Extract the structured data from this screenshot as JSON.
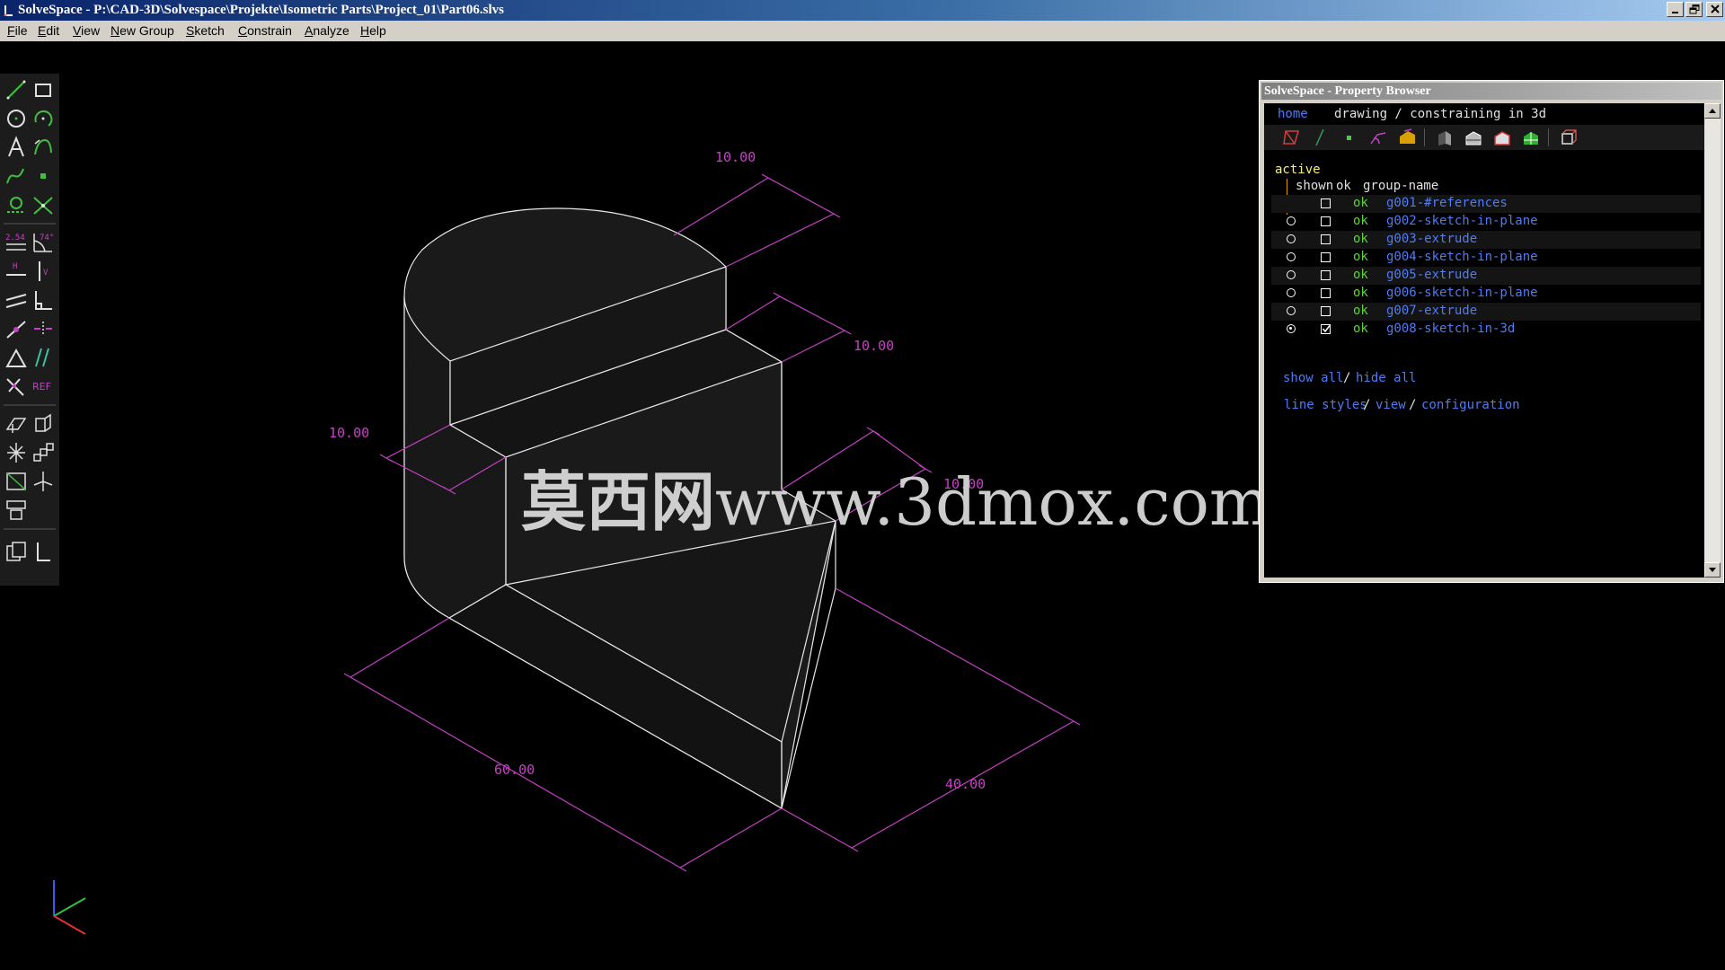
{
  "window": {
    "title": "SolveSpace - P:\\CAD-3D\\Solvespace\\Projekte\\Isometric Parts\\Project_01\\Part06.slvs",
    "icon": "solvespace-app-icon",
    "controls": [
      "minimize-icon",
      "restore-icon",
      "close-icon"
    ]
  },
  "menu": [
    {
      "key": "F",
      "rest": "ile"
    },
    {
      "key": "E",
      "rest": "dit"
    },
    {
      "key": "V",
      "rest": "iew"
    },
    {
      "key": "N",
      "rest": "ew Group"
    },
    {
      "key": "S",
      "rest": "ketch"
    },
    {
      "key": "C",
      "rest": "onstrain"
    },
    {
      "key": "A",
      "rest": "nalyze"
    },
    {
      "key": "H",
      "rest": "elp"
    }
  ],
  "toolbar": {
    "tools": [
      "line-icon",
      "rectangle-icon",
      "circle-icon",
      "arc-icon",
      "text-icon",
      "tangent-arc-icon",
      "bezier-icon",
      "point-icon",
      "construction-icon",
      "split-icon",
      "distance-icon",
      "angle-icon",
      "horizontal-icon",
      "vertical-icon",
      "parallel-icon",
      "perpendicular-icon",
      "point-on-line-icon",
      "symmetric-icon",
      "equal-icon",
      "other-angle-icon",
      "reference-icon",
      "workplane-icon",
      "extrude-icon",
      "lathe-icon",
      "step-rotate-icon",
      "step-translate-icon",
      "sketch-in-plane-icon",
      "sketch-in-3d-icon",
      "assemble-icon",
      "link-icon",
      "nearest-iso-icon"
    ],
    "reference_label": "REF",
    "distance_label": "2.54",
    "angle_label": "74°",
    "horizontal_label": "H",
    "vertical_label": "V"
  },
  "dimensions": {
    "d1": "10.00",
    "d2": "10.00",
    "d3": "10.00",
    "d4": "10.00",
    "d5": "60.00",
    "d6": "40.00"
  },
  "watermark": {
    "cn": "莫西网",
    "url": "www.3dmox.com"
  },
  "colors": {
    "dimension": "#c540c5",
    "edge": "#e8e8e8",
    "link": "#4f7cf5",
    "ok": "#5fd23c",
    "axis_x": "#e03030",
    "axis_y": "#30c040",
    "axis_z": "#3a5cf0"
  },
  "property_browser": {
    "title": "SolveSpace - Property Browser",
    "nav": {
      "home": "home",
      "crumb": "drawing / constraining in 3d"
    },
    "icons": [
      "hide-workplanes-icon",
      "hide-normals-icon",
      "hide-points-icon",
      "hide-constraints-icon",
      "hide-faces-icon",
      "show-shaded-icon",
      "show-edges-icon",
      "show-outlines-icon",
      "show-mesh-icon",
      "show-hidden-lines-icon"
    ],
    "active_label": "active",
    "headers": {
      "shown": "shown",
      "ok": "ok",
      "name": "group-name"
    },
    "groups": [
      {
        "name": "g001-#references",
        "ok": "ok",
        "radio": false,
        "checked": false
      },
      {
        "name": "g002-sketch-in-plane",
        "ok": "ok",
        "radio": true,
        "checked": false
      },
      {
        "name": "g003-extrude",
        "ok": "ok",
        "radio": true,
        "checked": false
      },
      {
        "name": "g004-sketch-in-plane",
        "ok": "ok",
        "radio": true,
        "checked": false
      },
      {
        "name": "g005-extrude",
        "ok": "ok",
        "radio": true,
        "checked": false
      },
      {
        "name": "g006-sketch-in-plane",
        "ok": "ok",
        "radio": true,
        "checked": false
      },
      {
        "name": "g007-extrude",
        "ok": "ok",
        "radio": true,
        "checked": false
      },
      {
        "name": "g008-sketch-in-3d",
        "ok": "ok",
        "radio": true,
        "active": true,
        "checked": true
      }
    ],
    "show_all": "show all",
    "slash": "/",
    "hide_all": "hide all",
    "line_styles": "line styles",
    "view": "view",
    "configuration": "configuration"
  }
}
